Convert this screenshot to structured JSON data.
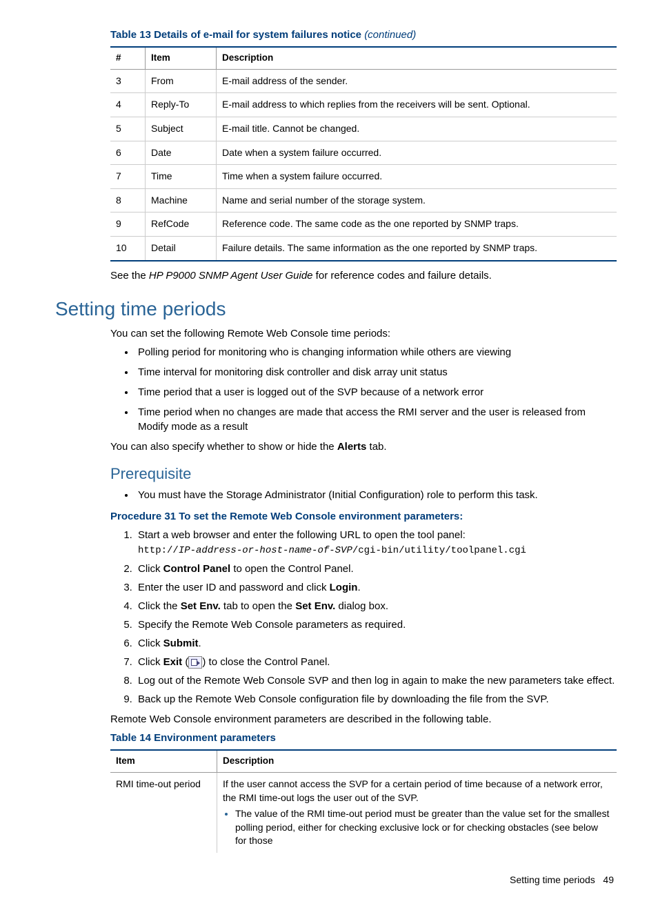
{
  "table13": {
    "caption_prefix": "Table 13 Details of e-mail for system failures notice ",
    "caption_suffix": "(continued)",
    "headers": [
      "#",
      "Item",
      "Description"
    ],
    "rows": [
      {
        "n": "3",
        "item": "From",
        "desc": "E-mail address of the sender."
      },
      {
        "n": "4",
        "item": "Reply-To",
        "desc": "E-mail address to which replies from the receivers will be sent. Optional."
      },
      {
        "n": "5",
        "item": "Subject",
        "desc": "E-mail title. Cannot be changed."
      },
      {
        "n": "6",
        "item": "Date",
        "desc": "Date when a system failure occurred."
      },
      {
        "n": "7",
        "item": "Time",
        "desc": "Time when a system failure occurred."
      },
      {
        "n": "8",
        "item": "Machine",
        "desc": "Name and serial number of the storage system."
      },
      {
        "n": "9",
        "item": "RefCode",
        "desc": "Reference code. The same code as the one reported by SNMP traps."
      },
      {
        "n": "10",
        "item": "Detail",
        "desc": "Failure details. The same information as the one reported by SNMP traps."
      }
    ],
    "after_a": "See the ",
    "after_b": "HP P9000 SNMP Agent User Guide",
    "after_c": " for reference codes and failure details."
  },
  "section": {
    "title": "Setting time periods",
    "intro": "You can set the following Remote Web Console time periods:",
    "bullets": [
      "Polling period for monitoring who is changing information while others are viewing",
      "Time interval for monitoring disk controller and disk array unit status",
      "Time period that a user is logged out of the SVP because of a network error",
      "Time period when no changes are made that access the RMI server and the user is released from Modify mode as a result"
    ],
    "after_a": "You can also specify whether to show or hide the ",
    "after_b": "Alerts",
    "after_c": " tab."
  },
  "prereq": {
    "title": "Prerequisite",
    "bullet": "You must have the Storage Administrator (Initial Configuration) role to perform this task."
  },
  "procedure": {
    "title": "Procedure 31 To set the Remote Web Console environment parameters:",
    "step1": "Start a web browser and enter the following URL to open the tool panel:",
    "url_a": "http://",
    "url_b": "IP-address-or-host-name-of-SVP",
    "url_c": "/cgi-bin/utility/toolpanel.cgi",
    "step2a": "Click ",
    "step2b": "Control Panel",
    "step2c": " to open the Control Panel.",
    "step3a": "Enter the user ID and password and click ",
    "step3b": "Login",
    "step3c": ".",
    "step4a": "Click the ",
    "step4b": "Set Env.",
    "step4c": " tab to open the ",
    "step4d": "Set Env.",
    "step4e": " dialog box.",
    "step5": "Specify the Remote Web Console parameters as required.",
    "step6a": "Click ",
    "step6b": "Submit",
    "step6c": ".",
    "step7a": "Click ",
    "step7b": "Exit",
    "step7c": " (",
    "step7d": ") to close the Control Panel.",
    "step8": "Log out of the Remote Web Console SVP and then log in again to make the new parameters take effect.",
    "step9": "Back up the Remote Web Console configuration file by downloading the file from the SVP.",
    "after": "Remote Web Console environment parameters are described in the following table."
  },
  "table14": {
    "caption": "Table 14 Environment parameters",
    "headers": [
      "Item",
      "Description"
    ],
    "row1_item": "RMI time-out period",
    "row1_desc": "If the user cannot access the SVP for a certain period of time because of a network error, the RMI time-out logs the user out of the SVP.",
    "row1_bullet": "The value of the RMI time-out period must be greater than the value set for the smallest polling period, either for checking exclusive lock or for checking obstacles (see below for those"
  },
  "footer": {
    "label": "Setting time periods",
    "page": "49"
  }
}
